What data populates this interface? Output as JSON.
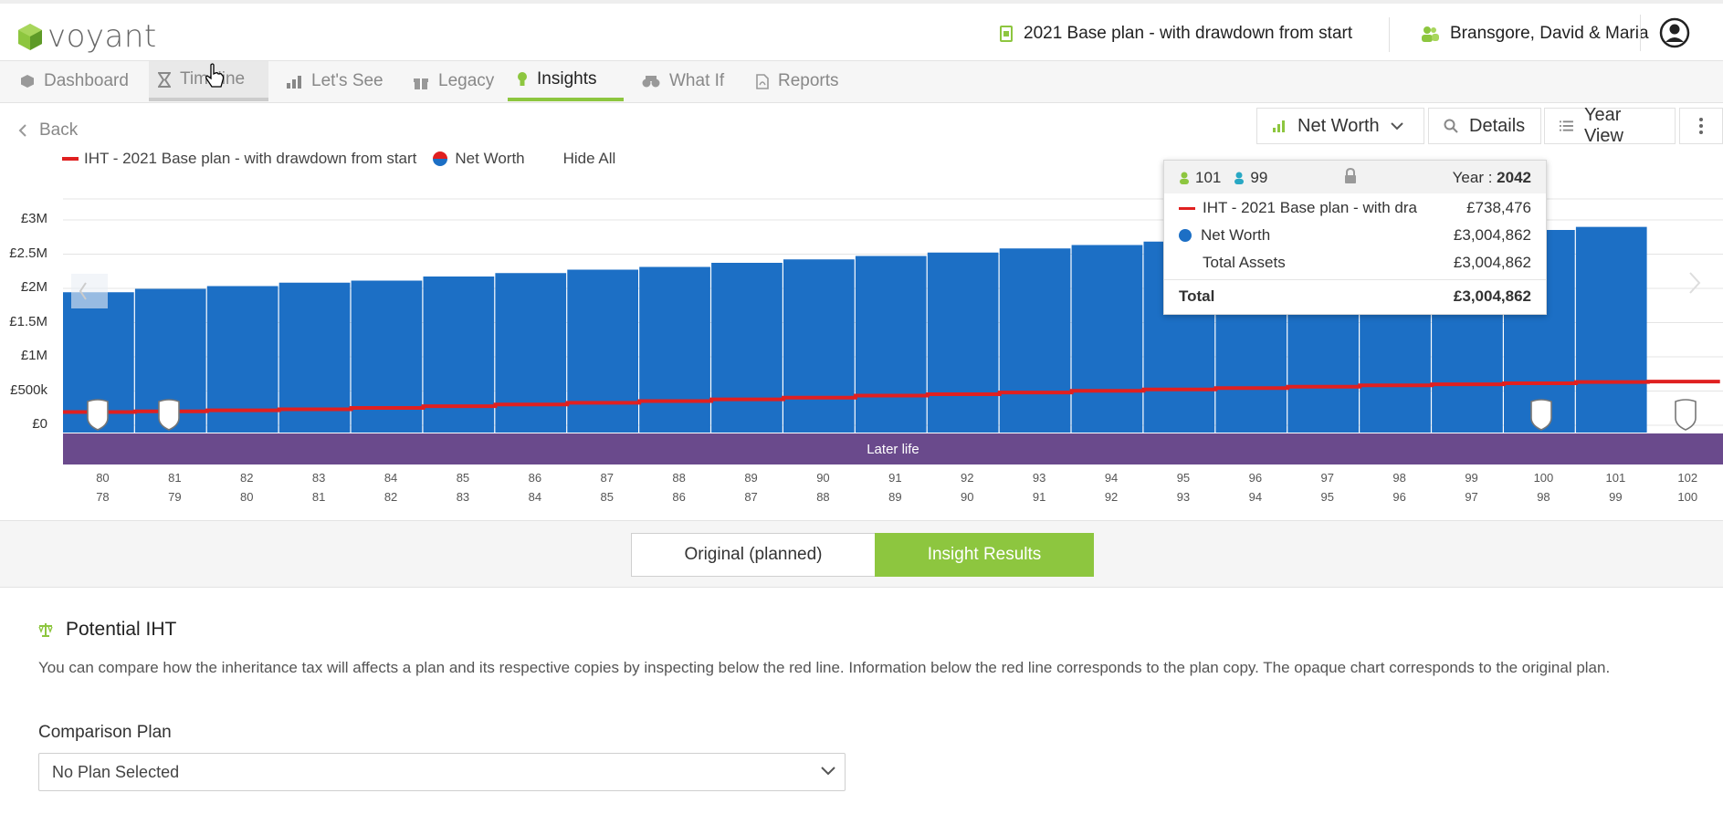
{
  "app": {
    "logo_text": "voyant",
    "plan_name": "2021 Base plan - with drawdown from start",
    "client_name": "Bransgore, David & Maria"
  },
  "nav": {
    "items": [
      {
        "label": "Dashboard",
        "icon": "cube-icon"
      },
      {
        "label": "Timeline",
        "icon": "hourglass-icon"
      },
      {
        "label": "Let's See",
        "icon": "bar-chart-icon"
      },
      {
        "label": "Legacy",
        "icon": "gift-icon"
      },
      {
        "label": "Insights",
        "icon": "lightbulb-icon"
      },
      {
        "label": "What If",
        "icon": "binoculars-icon"
      },
      {
        "label": "Reports",
        "icon": "pdf-icon"
      }
    ],
    "active": "Insights"
  },
  "toolbar": {
    "back_label": "Back",
    "metric_label": "Net Worth",
    "details_label": "Details",
    "yearview_label": "Year View"
  },
  "legend": {
    "iht_label": "IHT - 2021 Base plan - with drawdown from start",
    "networth_label": "Net Worth",
    "hide_all_label": "Hide All"
  },
  "tooltip": {
    "person1_age": "101",
    "person2_age": "99",
    "year_label": "Year :",
    "year_value": "2042",
    "rows": [
      {
        "label": "IHT - 2021 Base plan - with dra",
        "value": "£738,476"
      },
      {
        "label": "Net Worth",
        "value": "£3,004,862"
      },
      {
        "label": "Total Assets",
        "value": "£3,004,862"
      }
    ],
    "total_label": "Total",
    "total_value": "£3,004,862"
  },
  "life_stage": "Later life",
  "chart_data": {
    "type": "bar",
    "categories": [
      "80/78",
      "81/79",
      "82/80",
      "83/81",
      "84/82",
      "85/83",
      "86/84",
      "87/85",
      "88/86",
      "89/87",
      "90/88",
      "91/89",
      "92/90",
      "93/91",
      "94/92",
      "95/93",
      "96/94",
      "97/95",
      "98/96",
      "99/97",
      "100/98",
      "101/99",
      "102/100"
    ],
    "x_ages_person1": [
      "80",
      "81",
      "82",
      "83",
      "84",
      "85",
      "86",
      "87",
      "88",
      "89",
      "90",
      "91",
      "92",
      "93",
      "94",
      "95",
      "96",
      "97",
      "98",
      "99",
      "100",
      "101",
      "102"
    ],
    "x_ages_person2": [
      "78",
      "79",
      "80",
      "81",
      "82",
      "83",
      "84",
      "85",
      "86",
      "87",
      "88",
      "89",
      "90",
      "91",
      "92",
      "93",
      "94",
      "95",
      "96",
      "97",
      "98",
      "99",
      "100"
    ],
    "series": [
      {
        "name": "Net Worth",
        "color": "#1c6fc5",
        "values": [
          2050000,
          2100000,
          2140000,
          2190000,
          2220000,
          2280000,
          2330000,
          2380000,
          2420000,
          2480000,
          2530000,
          2580000,
          2630000,
          2690000,
          2740000,
          2790000,
          2840000,
          2880000,
          2910000,
          2940000,
          2960000,
          3004862,
          null
        ]
      },
      {
        "name": "IHT - 2021 Base plan - with drawdown from start",
        "color": "#e02020",
        "values": [
          300000,
          310000,
          325000,
          340000,
          360000,
          385000,
          410000,
          435000,
          460000,
          485000,
          510000,
          540000,
          560000,
          585000,
          610000,
          630000,
          650000,
          670000,
          690000,
          705000,
          720000,
          738476,
          745000
        ]
      }
    ],
    "y_ticks": [
      "£0",
      "£500k",
      "£1M",
      "£1.5M",
      "£2M",
      "£2.5M",
      "£3M"
    ],
    "ylim": [
      0,
      3000000
    ]
  },
  "toggle": {
    "original_label": "Original (planned)",
    "insight_label": "Insight Results"
  },
  "potential_iht": {
    "title": "Potential IHT",
    "description": "You can compare how the inheritance tax will affects a plan and its respective copies by inspecting below the red line. Information below the red line corresponds to the plan copy. The opaque chart corresponds to the original plan.",
    "comparison_label": "Comparison Plan",
    "comparison_value": "No Plan Selected"
  },
  "colors": {
    "accent_green": "#8dc63f",
    "bar_blue": "#1c6fc5",
    "iht_red": "#e02020",
    "life_purple": "#6a4a8c"
  }
}
